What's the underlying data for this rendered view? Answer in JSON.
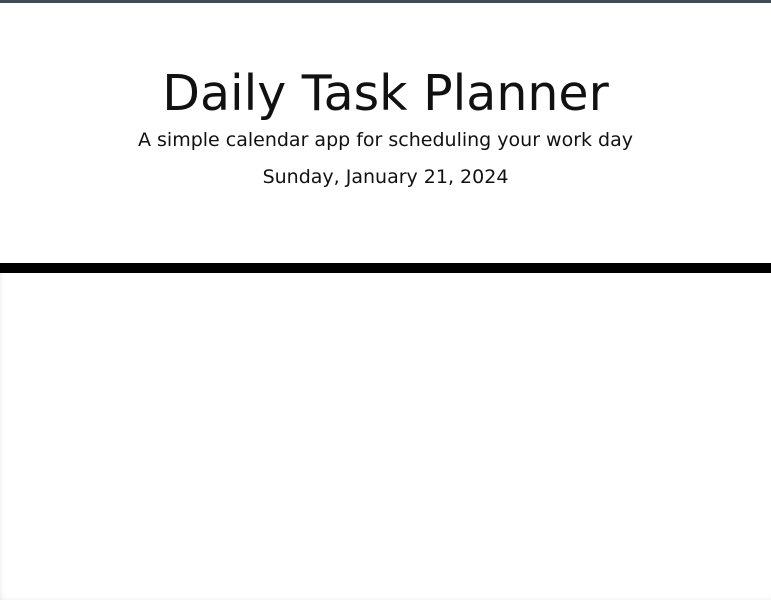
{
  "header": {
    "title": "Daily Task Planner",
    "subtitle": "A simple calendar app for scheduling your work day",
    "current_date": "Sunday, January 21, 2024"
  }
}
